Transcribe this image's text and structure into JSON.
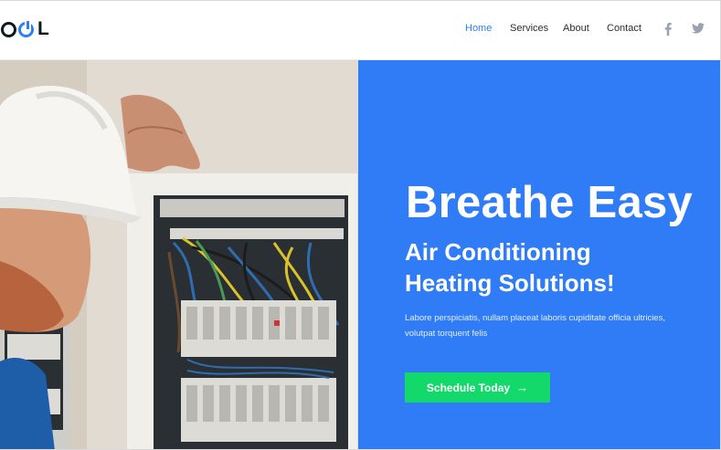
{
  "brand": {
    "logo_text": "OOL"
  },
  "nav": {
    "items": [
      {
        "label": "Home",
        "active": true
      },
      {
        "label": "Services"
      },
      {
        "label": "About"
      },
      {
        "label": "Contact"
      }
    ],
    "social": [
      "facebook-icon",
      "twitter-icon"
    ]
  },
  "hero": {
    "title": "Breathe Easy",
    "subtitle_line1": "Air Conditioning",
    "subtitle_line2": "Heating Solutions!",
    "body": "Labore perspiciatis, nullam placeat laboris cupiditate officia ultricies, volutpat torquent felis",
    "cta_label": "Schedule Today",
    "cta_icon": "arrow-right-icon"
  },
  "colors": {
    "accent": "#2f7cf6",
    "cta": "#13d86a",
    "nav_active": "#2d7ff9",
    "text_dark": "#101820"
  }
}
